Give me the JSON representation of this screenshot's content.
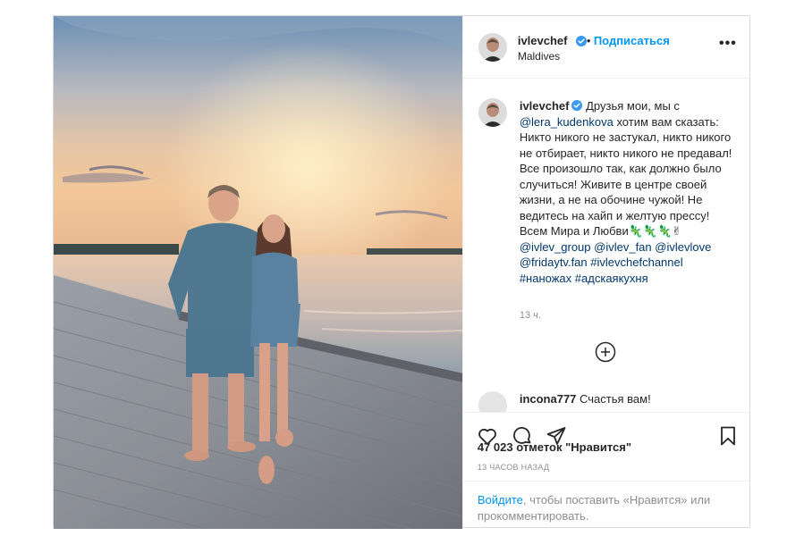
{
  "header": {
    "username": "ivlevchef",
    "separator": "•",
    "follow_label": "Подписаться",
    "location": "Maldives",
    "more_label": "•••"
  },
  "caption": {
    "username": "ivlevchef",
    "text_1": "Друзья мои, мы с",
    "mention_1": "@lera_kudenkova",
    "text_2": "хотим вам сказать: Никто никого не застукал, никто никого не отбирает, никто никого не предавал! Все произошло так, как должно было случиться! Живите в центре своей жизни, а не на обочине чужой! Не ведитесь на хайп и желтую прессу!Всем Мира и Любви",
    "emoji": "🦎🦎🦎✌",
    "tags": [
      "@ivlev_group",
      "@ivlev_fan",
      "@ivlevlove",
      "@fridaytv.fan",
      "#ivlevchefchannel",
      "#наножах",
      "#адскаякухня"
    ],
    "time": "13 ч."
  },
  "comment": {
    "username": "incona777",
    "text": "Счастья вам!"
  },
  "icons": {
    "like": "heart-icon",
    "comment": "comment-icon",
    "share": "share-icon",
    "save": "bookmark-icon",
    "load_more": "plus-circle-icon",
    "verified": "verified-badge-icon"
  },
  "footer": {
    "likes": "47 023 отметок \"Нравится\"",
    "timestamp": "13 ЧАСОВ НАЗАД",
    "login_link": "Войдите",
    "login_text": ", чтобы поставить «Нравится» или прокомментировать."
  },
  "colors": {
    "link_blue": "#0095f6",
    "mention_blue": "#00376b",
    "verified_blue": "#3897f0",
    "muted": "#8e8e8e",
    "text": "#262626"
  }
}
